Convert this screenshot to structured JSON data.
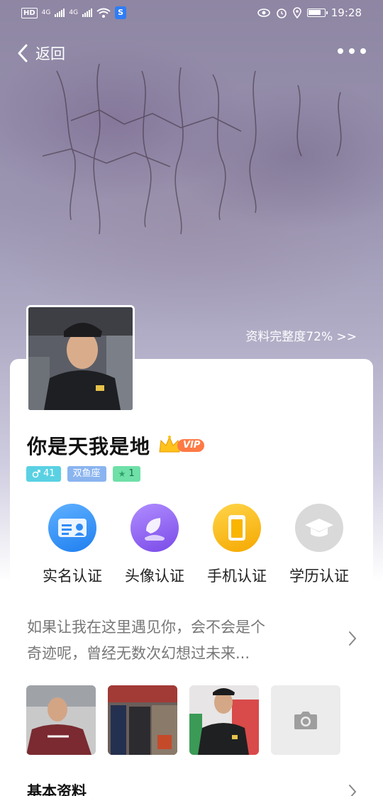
{
  "status_bar": {
    "carrier_chip": "HD",
    "network_1": "4G",
    "network_2": "4G",
    "security_badge": "S",
    "time": "19:28",
    "icons": [
      "hd-icon",
      "signal-icon",
      "signal-icon",
      "wifi-icon",
      "shield-icon",
      "eye-icon",
      "alarm-icon",
      "location-icon",
      "battery-icon"
    ]
  },
  "navbar": {
    "back_label": "返回",
    "more_icon": "more-dots-icon"
  },
  "profile": {
    "completeness": "资料完整度72% >>",
    "nickname": "你是天我是地",
    "vip_label": "VIP",
    "tags": {
      "age": "41",
      "zodiac": "双鱼座",
      "level": "1"
    },
    "verifications": [
      {
        "label": "实名认证",
        "icon": "id-card-icon",
        "color": "#2f8cf5"
      },
      {
        "label": "头像认证",
        "icon": "portrait-icon",
        "color": "#8b5cf0"
      },
      {
        "label": "手机认证",
        "icon": "phone-icon",
        "color": "#f9b500"
      },
      {
        "label": "学历认证",
        "icon": "graduation-cap-icon",
        "color": "#d6d6d6"
      }
    ],
    "bio_line1": "如果让我在这里遇见你，会不会是个",
    "bio_line2": "奇迹呢，曾经无数次幻想过未来...",
    "add_photo_icon": "camera-icon",
    "section_title": "基本资料"
  },
  "colors": {
    "accent_blue": "#2f8cf5",
    "accent_purple": "#8b5cf0",
    "accent_yellow": "#f9b500",
    "vip_orange": "#ff7a45"
  }
}
